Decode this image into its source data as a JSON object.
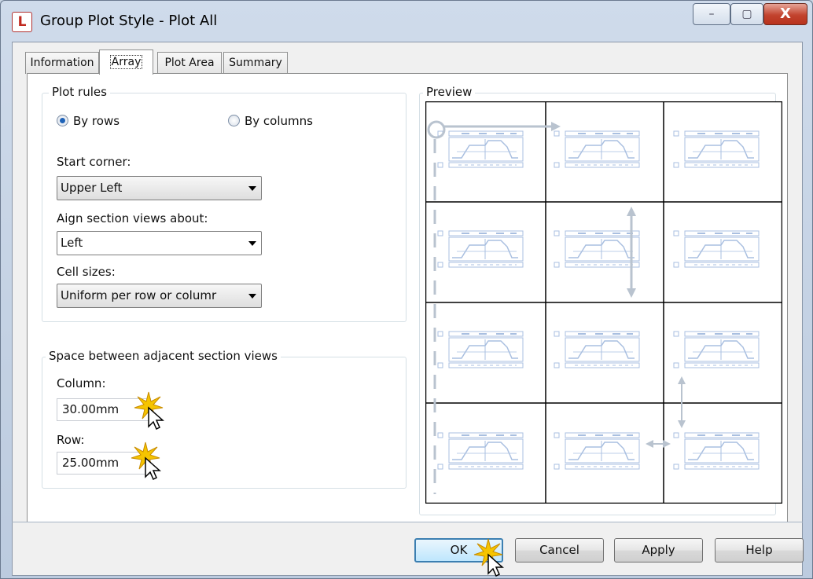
{
  "window": {
    "title": "Group Plot Style - Plot All",
    "app_icon": "autocad-icon",
    "controls": {
      "minimize": "–",
      "maximize": "▢",
      "close": "X"
    }
  },
  "tabs": [
    {
      "label": "Information",
      "active": false
    },
    {
      "label": "Array",
      "active": true
    },
    {
      "label": "Plot Area",
      "active": false
    },
    {
      "label": "Summary",
      "active": false
    }
  ],
  "plot_rules": {
    "legend": "Plot rules",
    "radio_by_rows": "By rows",
    "radio_by_columns": "By columns",
    "selected": "By rows",
    "start_corner_label": "Start corner:",
    "start_corner_value": "Upper Left",
    "align_label": "Aign section views about:",
    "align_value": "Left",
    "cell_sizes_label": "Cell sizes:",
    "cell_sizes_value": "Uniform per row or columr"
  },
  "spacing": {
    "legend": "Space between adjacent section views",
    "column_label": "Column:",
    "column_value": "30.00mm",
    "row_label": "Row:",
    "row_value": "25.00mm"
  },
  "preview": {
    "legend": "Preview",
    "rows": 4,
    "columns": 3
  },
  "buttons": {
    "ok": "OK",
    "cancel": "Cancel",
    "apply": "Apply",
    "help": "Help"
  },
  "colors": {
    "accent": "#3c7fb1",
    "preview_sketch": "#a9bfe0",
    "highlight": "#f5c400"
  }
}
